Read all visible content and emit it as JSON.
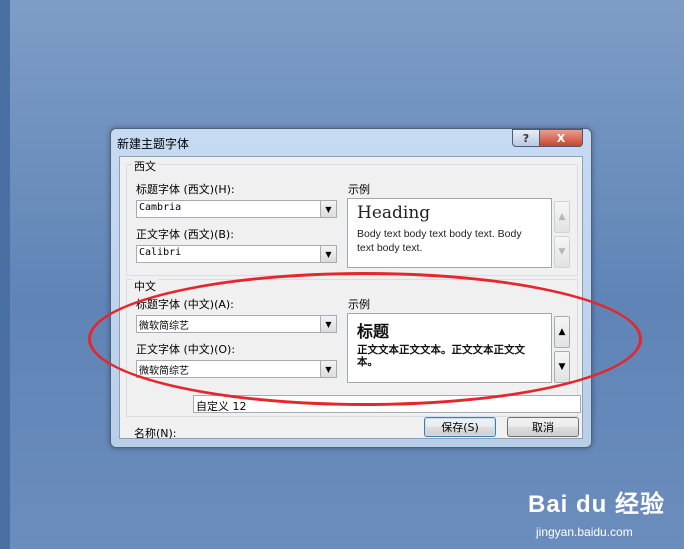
{
  "dialog": {
    "title": "新建主题字体",
    "help_glyph": "?",
    "close_glyph": "X",
    "western": {
      "legend": "西文",
      "heading_label": "标题字体 (西文)(H):",
      "heading_value": "Cambria",
      "body_label": "正文字体 (西文)(B):",
      "body_value": "Calibri",
      "sample_label": "示例",
      "sample_heading": "Heading",
      "sample_body": "Body text body text body text. Body text body text."
    },
    "asian": {
      "legend": "中文",
      "heading_label": "标题字体 (中文)(A):",
      "heading_value": "微软简综艺",
      "body_label": "正文字体 (中文)(O):",
      "body_value": "微软简综艺",
      "sample_label": "示例",
      "sample_heading": "标题",
      "sample_body": "正文文本正文文本。正文文本正文文本。"
    },
    "name_label": "名称(N):",
    "name_value": "自定义 12",
    "save_label": "保存(S)",
    "cancel_label": "取消"
  },
  "icons": {
    "dropdown": "▼",
    "scroll_up": "▲",
    "scroll_down": "▼"
  },
  "annotation_color": "#e5262d",
  "watermark": {
    "brand": "Bai du 经验",
    "url": "jingyan.baidu.com"
  }
}
